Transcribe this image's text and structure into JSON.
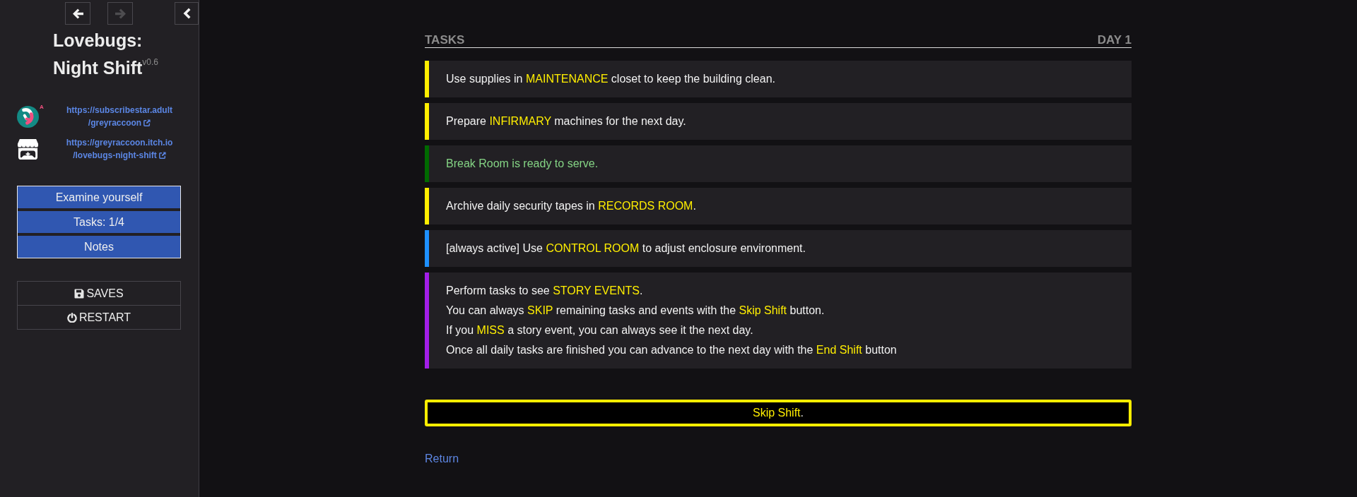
{
  "sidebar": {
    "nav": [
      {
        "kind": "back",
        "disabled": false
      },
      {
        "kind": "forward",
        "disabled": true
      },
      {
        "kind": "collapse",
        "disabled": false
      }
    ],
    "title": "Lovebugs: Night Shift",
    "version": "v0.6",
    "links": [
      {
        "kind": "ring",
        "badge": "A",
        "lines": [
          "https://subscribestar.adult",
          "/greyraccoon"
        ]
      },
      {
        "kind": "store",
        "lines": [
          "https://greyraccoon.itch.io",
          "/lovebugs-night-shift"
        ]
      }
    ],
    "menu": [
      "Examine yourself",
      "Tasks: 1/4",
      "Notes"
    ],
    "actions": [
      {
        "kind": "save",
        "label": "SAVES"
      },
      {
        "kind": "restart",
        "label": "RESTART"
      }
    ]
  },
  "header": {
    "title": "TASKS",
    "day": "DAY 1"
  },
  "tasks": [
    {
      "color": "#ffee00",
      "completed": false,
      "lines": [
        [
          {
            "text": "Use supplies in ",
            "highlight": false
          },
          {
            "text": "MAINTENANCE",
            "highlight": true
          },
          {
            "text": " closet to keep the building clean.",
            "highlight": false
          }
        ]
      ]
    },
    {
      "color": "#ffee00",
      "completed": false,
      "lines": [
        [
          {
            "text": "Prepare ",
            "highlight": false
          },
          {
            "text": "INFIRMARY",
            "highlight": true
          },
          {
            "text": " machines for the next day.",
            "highlight": false
          }
        ]
      ]
    },
    {
      "color": "#006a00",
      "completed": true,
      "lines": [
        [
          {
            "text": "Break Room is ready to serve.",
            "highlight": false
          }
        ]
      ]
    },
    {
      "color": "#ffee00",
      "completed": false,
      "lines": [
        [
          {
            "text": "Archive daily security tapes in ",
            "highlight": false
          },
          {
            "text": "RECORDS ROOM",
            "highlight": true
          },
          {
            "text": ".",
            "highlight": false
          }
        ]
      ]
    },
    {
      "color": "#1e90ff",
      "completed": false,
      "lines": [
        [
          {
            "text": "[always active] Use ",
            "highlight": false
          },
          {
            "text": "CONTROL ROOM",
            "highlight": true
          },
          {
            "text": " to adjust enclosure environment.",
            "highlight": false
          }
        ]
      ]
    },
    {
      "color": "#a21ee8",
      "completed": false,
      "lines": [
        [
          {
            "text": "Perform tasks to see ",
            "highlight": false
          },
          {
            "text": "STORY EVENTS",
            "highlight": true
          },
          {
            "text": ".",
            "highlight": false
          }
        ],
        [
          {
            "text": "You can always ",
            "highlight": false
          },
          {
            "text": "SKIP",
            "highlight": true
          },
          {
            "text": " remaining tasks and events with the ",
            "highlight": false
          },
          {
            "text": "Skip Shift",
            "highlight": true
          },
          {
            "text": " button.",
            "highlight": false
          }
        ],
        [
          {
            "text": "If you ",
            "highlight": false
          },
          {
            "text": "MISS",
            "highlight": true
          },
          {
            "text": " a story event, you can always see it the next day.",
            "highlight": false
          }
        ],
        [
          {
            "text": "Once all daily tasks are finished you can advance to the next day with the ",
            "highlight": false
          },
          {
            "text": "End Shift",
            "highlight": true
          },
          {
            "text": " button",
            "highlight": false
          }
        ]
      ]
    }
  ],
  "skip_button": [
    {
      "text": "Skip Shift",
      "highlight": true
    },
    {
      "text": ".",
      "highlight": false
    }
  ],
  "return_link": "Return"
}
